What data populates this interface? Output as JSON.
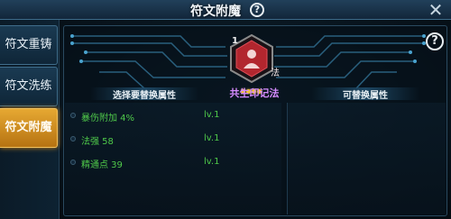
{
  "window": {
    "title": "符文附魔",
    "help_glyph": "?",
    "close_glyph": "✕"
  },
  "sidebar": {
    "tabs": [
      {
        "label": "符文重铸",
        "active": false
      },
      {
        "label": "符文洗练",
        "active": false
      },
      {
        "label": "符文附魔",
        "active": true
      }
    ]
  },
  "emblem": {
    "level": "1",
    "type": "法",
    "name": "共生印记法",
    "stars": 4
  },
  "sections": {
    "left_label": "选择要替换属性",
    "right_label": "可替换属性"
  },
  "attributes": [
    {
      "name": "暴伤附加 4%",
      "level": "lv.1"
    },
    {
      "name": "法强 58",
      "level": "lv.1"
    },
    {
      "name": "精通点 39",
      "level": "lv.1"
    }
  ],
  "colors": {
    "accent_gold": "#e6a832",
    "attr_green": "#4fc94a",
    "emblem_red": "#b2262e",
    "name_purple": "#d68cff"
  }
}
